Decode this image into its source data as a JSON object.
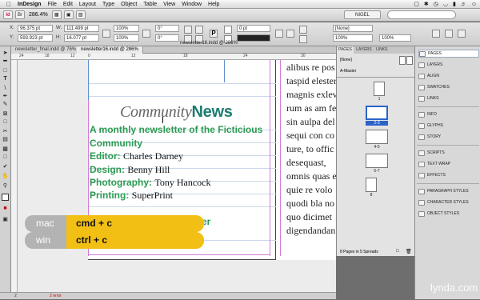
{
  "menu": {
    "app": "InDesign",
    "items": [
      "File",
      "Edit",
      "Layout",
      "Type",
      "Object",
      "Table",
      "View",
      "Window",
      "Help"
    ],
    "status_icons": [
      "monitor-icon",
      "bluetooth-icon",
      "clock-icon",
      "wifi-icon",
      "battery-icon",
      "volume-icon",
      "user-icon"
    ]
  },
  "appbar": {
    "zoom": "286.4%",
    "workspace": "NIGEL"
  },
  "control": {
    "x": "96.375 pt",
    "y": "593.923 pt",
    "w": "111.499 pt",
    "h": "16.077 pt",
    "scale_x": "100%",
    "scale_y": "100%",
    "rotate": "0°",
    "shear": "0°",
    "stroke_weight": "0 pt",
    "swatch": "[None]",
    "percent": "100%",
    "opacity": "100%"
  },
  "tabs": [
    {
      "label": "newsletter_final.indd @ 76%"
    },
    {
      "label": "newsletter16.indd @ 286%"
    }
  ],
  "window_title": "newsletter16.indd @ 286%",
  "ruler": [
    "24",
    "18",
    "12",
    "6",
    "0",
    "6",
    "12",
    "18",
    "24",
    "30"
  ],
  "doc": {
    "masthead_1": "Community",
    "masthead_2": "News",
    "tagline_1": "A monthly newsletter of the Ficticious",
    "tagline_2": "Community",
    "editor_label": "Editor:",
    "editor": "Charles Darney",
    "design_label": "Design:",
    "design": "Benny Hill",
    "photo_label": "Photography:",
    "photo": "Tony Hancock",
    "printing_label": "Printing:",
    "printing": "SuperPrint",
    "hidden_tail": "er",
    "body_col": [
      "alibus re pos",
      "taspid elester",
      "magnis exleve",
      "rum as am fe",
      "sin aulpa del",
      "sequi con co",
      "ture, to offic",
      "desequast,",
      "omnis quas e",
      "quie re volo",
      "quodi bla no",
      "quo dicimet",
      "digendandan"
    ]
  },
  "pages_panel": {
    "tabs": [
      "PAGES",
      "LAYERS",
      "LINKS"
    ],
    "none": "[None]",
    "master": "A-Master",
    "spreads": [
      "1",
      "2-3",
      "4-5",
      "6-7",
      "8"
    ],
    "footer": "8 Pages in 5 Spreads"
  },
  "right_panels": [
    "PAGES",
    "LAYERS",
    "ALIGN",
    "SWATCHES",
    "LINKS",
    "INFO",
    "GLYPHS",
    "STORY",
    "SCRIPTS",
    "TEXT WRAP",
    "EFFECTS",
    "PARAGRAPH STYLES",
    "CHARACTER STYLES",
    "OBJECT STYLES"
  ],
  "status": {
    "page": "2",
    "errors": "2 error"
  },
  "shortcut": {
    "mac_label": "mac",
    "mac_keys": "cmd + c",
    "win_label": "win",
    "win_keys": "ctrl + c"
  },
  "watermark": "lynda.com"
}
